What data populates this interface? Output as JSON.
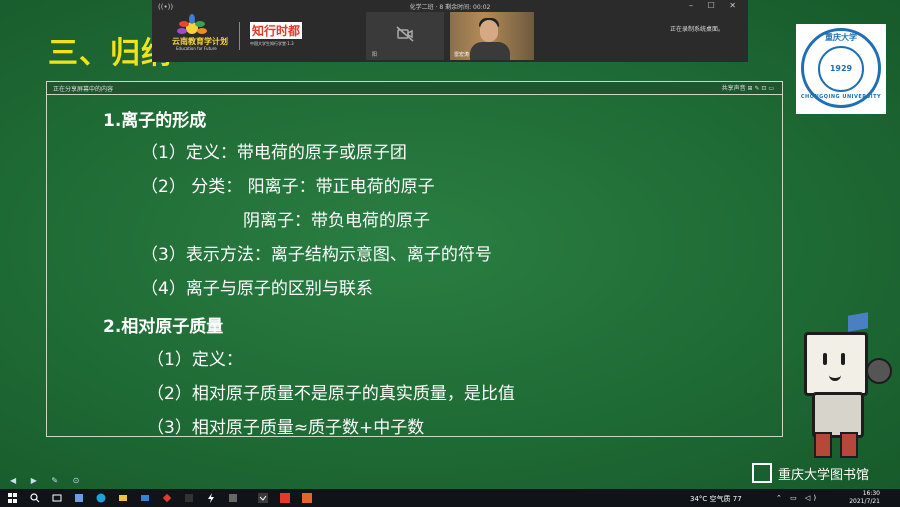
{
  "slide": {
    "title": "三、归纳"
  },
  "meeting": {
    "record_indicator": "((•))",
    "title": "化学二班 · 8  剩余时间: 00:02",
    "window_controls": "– ☐ ✕",
    "logo1_name": "云南教育学计划",
    "logo1_sub": "Education for Future",
    "logo2_name": "知行时都",
    "logo2_sub": "中国大学生知行学堂·1.3",
    "camoff_label": "阳",
    "camon_label": "雷宏涛",
    "recording_note": "正在录制系统桌面。"
  },
  "share_window": {
    "header_text": "正在分享屏幕中的内容",
    "header_right": "共享声音  ⊞  ✎  ⊡  ▭"
  },
  "content": {
    "section1_title": "1.离子的形成",
    "s1_item1": "（1）定义：带电荷的原子或原子团",
    "s1_item2a": "（2） 分类：  阳离子：带正电荷的原子",
    "s1_item2b": "阴离子：带负电荷的原子",
    "s1_item3": "（3）表示方法：离子结构示意图、离子的符号",
    "s1_item4": "（4）离子与原子的区别与联系",
    "section2_title": "2.相对原子质量",
    "s2_item1": "（1）定义：",
    "s2_item2": "（2）相对原子质量不是原子的真实质量，是比值",
    "s2_item3": "（3）相对原子质量≈质子数+中子数"
  },
  "university_logo": {
    "cn": "重庆大学",
    "year": "1929",
    "en": "CHONGQING UNIVERSITY"
  },
  "library": {
    "label": "重庆大学图书馆"
  },
  "taskbar": {
    "weather": "34°C 空气质 77",
    "tray": "⌃ ▭ ◁)",
    "time": "16:30",
    "date": "2021/7/21"
  }
}
